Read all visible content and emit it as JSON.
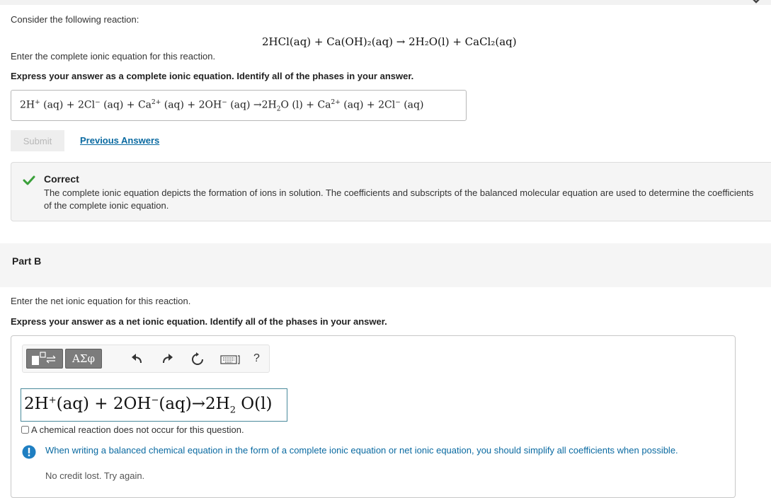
{
  "part_a": {
    "prompt": "Consider the following reaction:",
    "reaction": "2HCl(aq) + Ca(OH)₂(aq) → 2H₂O(l) + CaCl₂(aq)",
    "instruction": "Enter the complete ionic equation for this reaction.",
    "express": "Express your answer as a complete ionic equation. Identify all of the phases in your answer.",
    "answer": {
      "p1": "2H",
      "p1_sup": "+",
      "p2": " (aq) + 2Cl",
      "p2_sup": "−",
      "p3": " (aq) + Ca",
      "p3_sup": "2+",
      "p4": " (aq) + 2OH",
      "p4_sup": "−",
      "p5": " (aq) →2H",
      "p5_sub": "2",
      "p6": "O (l) + Ca",
      "p6_sup": "2+",
      "p7": " (aq) + 2Cl",
      "p7_sup": "−",
      "p8": " (aq)"
    },
    "submit_label": "Submit",
    "previous_answers_label": "Previous Answers",
    "feedback": {
      "title": "Correct",
      "body": "The complete ionic equation depicts the formation of ions in solution. The coefficients and subscripts of the balanced molecular equation are used to determine the coefficients of the complete ionic equation."
    }
  },
  "part_b": {
    "label": "Part B",
    "instruction": "Enter the net ionic equation for this reaction.",
    "express": "Express your answer as a net ionic equation. Identify all of the phases in your answer.",
    "toolbar": {
      "greek_label": "ΑΣφ",
      "help_label": "?"
    },
    "input": {
      "p1": "2H",
      "p1_sup": "+",
      "p2": "(aq) + 2OH",
      "p2_sup": "−",
      "p3": "(aq)→2H",
      "p3_sub": "2",
      "p4": " O(l)"
    },
    "no_reaction_label": "A chemical reaction does not occur for this question.",
    "alert": "When writing a balanced chemical equation in the form of a complete ionic equation or net ionic equation, you should simplify all coefficients when possible.",
    "credit": "No credit lost. Try again."
  },
  "colors": {
    "link": "#0a6aa1",
    "correct": "#3aa03a",
    "alert": "#0a6aa1"
  }
}
